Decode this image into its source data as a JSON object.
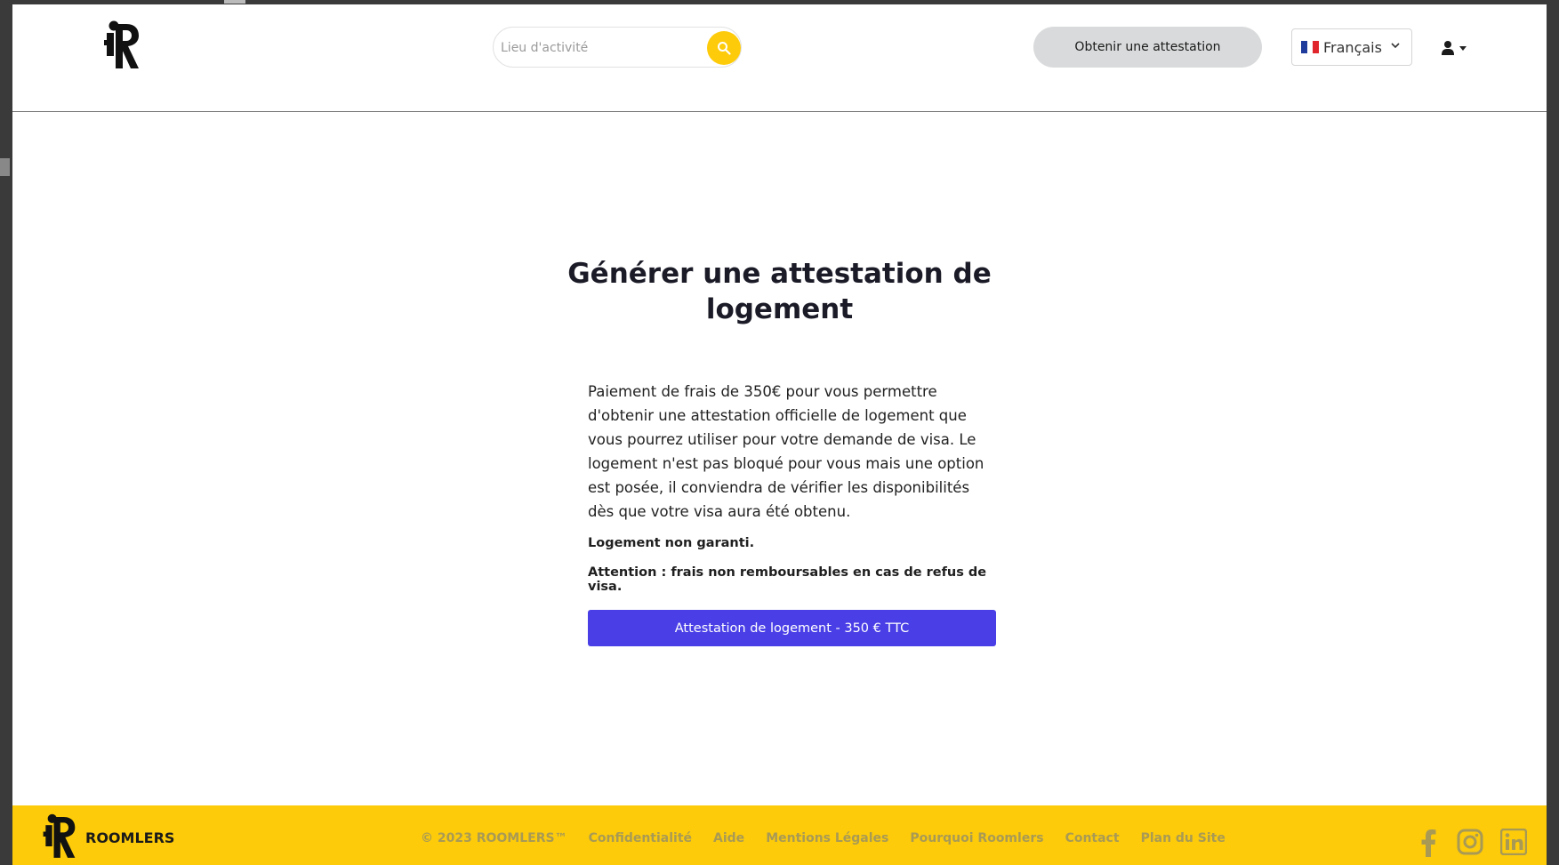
{
  "header": {
    "search": {
      "placeholder": "Lieu d'activité",
      "value": ""
    },
    "attestation_button": "Obtenir une attestation",
    "language": {
      "selected": "Français",
      "flag": "fr-flag-icon"
    },
    "user_menu": "user-icon"
  },
  "main": {
    "title": "Générer une attestation de logement",
    "description": "Paiement de frais de 350€ pour vous permettre d'obtenir une attestation officielle de logement que vous pourrez utiliser pour votre demande de visa. Le logement n'est pas bloqué pour vous mais une option est posée, il conviendra de vérifier les disponibilités dès que votre visa aura été obtenu.",
    "note_guarantee": "Logement non garanti.",
    "note_refund": "Attention : frais non remboursables en cas de refus de visa.",
    "pay_button": "Attestation de logement - 350 € TTC"
  },
  "footer": {
    "brand": "ROOMLERS",
    "links": [
      "© 2023 ROOMLERS™",
      "Confidentialité",
      "Aide",
      "Mentions Légales",
      "Pourquoi Roomlers",
      "Contact",
      "Plan du Site"
    ],
    "social": [
      "facebook-icon",
      "instagram-icon",
      "linkedin-icon"
    ]
  },
  "colors": {
    "accent_yellow": "#fdcb0a",
    "button_purple": "#4a3fe6",
    "footer_link": "#a89a55"
  }
}
